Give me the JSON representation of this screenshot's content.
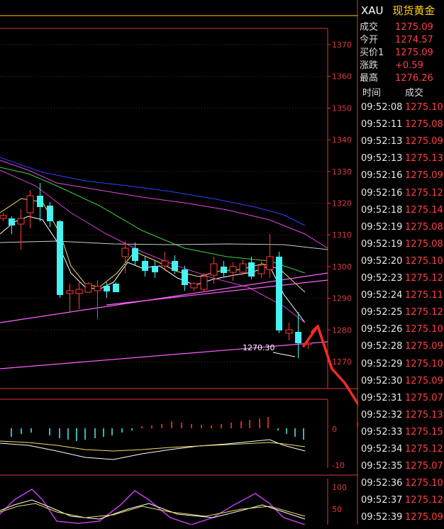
{
  "symbol": {
    "code": "XAU",
    "name": "现货黄金"
  },
  "quote": [
    {
      "label": "成交",
      "value": "1275.09"
    },
    {
      "label": "今开",
      "value": "1274.57"
    },
    {
      "label": "买价1",
      "value": "1275.09"
    },
    {
      "label": "涨跌",
      "value": "+0.59"
    },
    {
      "label": "最高",
      "value": "1276.26"
    }
  ],
  "trades_header": {
    "time": "时间",
    "price": "成交"
  },
  "trades": [
    {
      "time": "09:52:08",
      "price": "1275.10"
    },
    {
      "time": "09:52:11",
      "price": "1275.08"
    },
    {
      "time": "09:52:13",
      "price": "1275.09"
    },
    {
      "time": "09:52:13",
      "price": "1275.13"
    },
    {
      "time": "09:52:16",
      "price": "1275.09"
    },
    {
      "time": "09:52:16",
      "price": "1275.12"
    },
    {
      "time": "09:52:18",
      "price": "1275.14"
    },
    {
      "time": "09:52:19",
      "price": "1275.08"
    },
    {
      "time": "09:52:19",
      "price": "1275.08"
    },
    {
      "time": "09:52:20",
      "price": "1275.10"
    },
    {
      "time": "09:52:23",
      "price": "1275.12"
    },
    {
      "time": "09:52:24",
      "price": "1275.11"
    },
    {
      "time": "09:52:25",
      "price": "1275.12"
    },
    {
      "time": "09:52:26",
      "price": "1275.10"
    },
    {
      "time": "09:52:28",
      "price": "1275.09"
    },
    {
      "time": "09:52:29",
      "price": "1275.10"
    },
    {
      "time": "09:52:30",
      "price": "1275.09"
    },
    {
      "time": "09:52:31",
      "price": "1275.07"
    },
    {
      "time": "09:52:32",
      "price": "1275.13"
    },
    {
      "time": "09:52:33",
      "price": "1275.15"
    },
    {
      "time": "09:52:34",
      "price": "1275.12"
    },
    {
      "time": "09:52:35",
      "price": "1275.07"
    },
    {
      "time": "09:52:36",
      "price": "1275.10"
    },
    {
      "time": "09:52:37",
      "price": "1275.12"
    },
    {
      "time": "09:52:39",
      "price": "1275.09"
    }
  ],
  "price_axis": [
    "1370",
    "1360",
    "1350",
    "1340",
    "1330",
    "1320",
    "1310",
    "1300",
    "1290",
    "1280",
    "1270"
  ],
  "macd_axis": [
    "0",
    "-10"
  ],
  "kdj_axis": [
    "100",
    "50"
  ],
  "low_marker": "1270.30",
  "colors": {
    "up": "#ff3b3b",
    "down": "#44f4f4",
    "grid": "#e0393e"
  }
}
